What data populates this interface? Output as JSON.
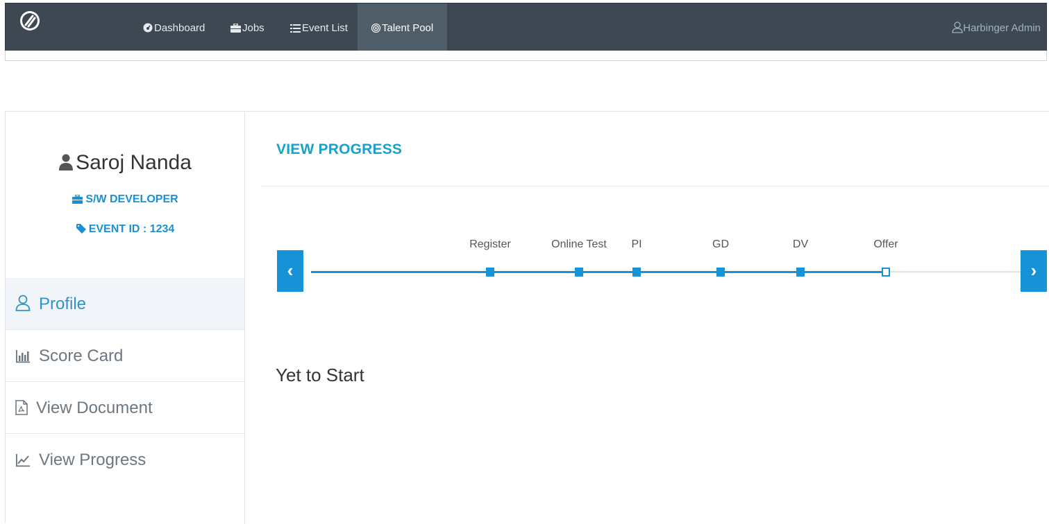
{
  "navbar": {
    "items": [
      {
        "label": "Dashboard",
        "icon": "dashboard-icon"
      },
      {
        "label": "Jobs",
        "icon": "briefcase-icon"
      },
      {
        "label": "Event List",
        "icon": "list-icon"
      },
      {
        "label": "Talent Pool",
        "icon": "target-icon",
        "active": true
      }
    ],
    "user": "Harbinger Admin",
    "colors": {
      "background": "#3d4853",
      "active": "#4f5d69"
    }
  },
  "candidate": {
    "name": "Saroj Nanda",
    "role": "S/W DEVELOPER",
    "event": "EVENT ID : 1234"
  },
  "sidebar": {
    "items": [
      {
        "label": "Profile",
        "icon": "user-outline-icon",
        "active": true
      },
      {
        "label": "Score Card",
        "icon": "bar-chart-icon"
      },
      {
        "label": "View Document",
        "icon": "pdf-file-icon"
      },
      {
        "label": "View Progress",
        "icon": "line-chart-icon"
      }
    ]
  },
  "progress": {
    "title": "VIEW PROGRESS",
    "stages": [
      {
        "label": "Register",
        "completed": true
      },
      {
        "label": "Online Test",
        "completed": true
      },
      {
        "label": "PI",
        "completed": true
      },
      {
        "label": "GD",
        "completed": true
      },
      {
        "label": "DV",
        "completed": true
      },
      {
        "label": "Offer",
        "completed": false
      }
    ],
    "prev_label": "‹",
    "next_label": "›",
    "status": "Yet to Start",
    "colors": {
      "accent": "#1593d6",
      "track": "#e2e4e6",
      "title": "#17a2c8"
    }
  }
}
